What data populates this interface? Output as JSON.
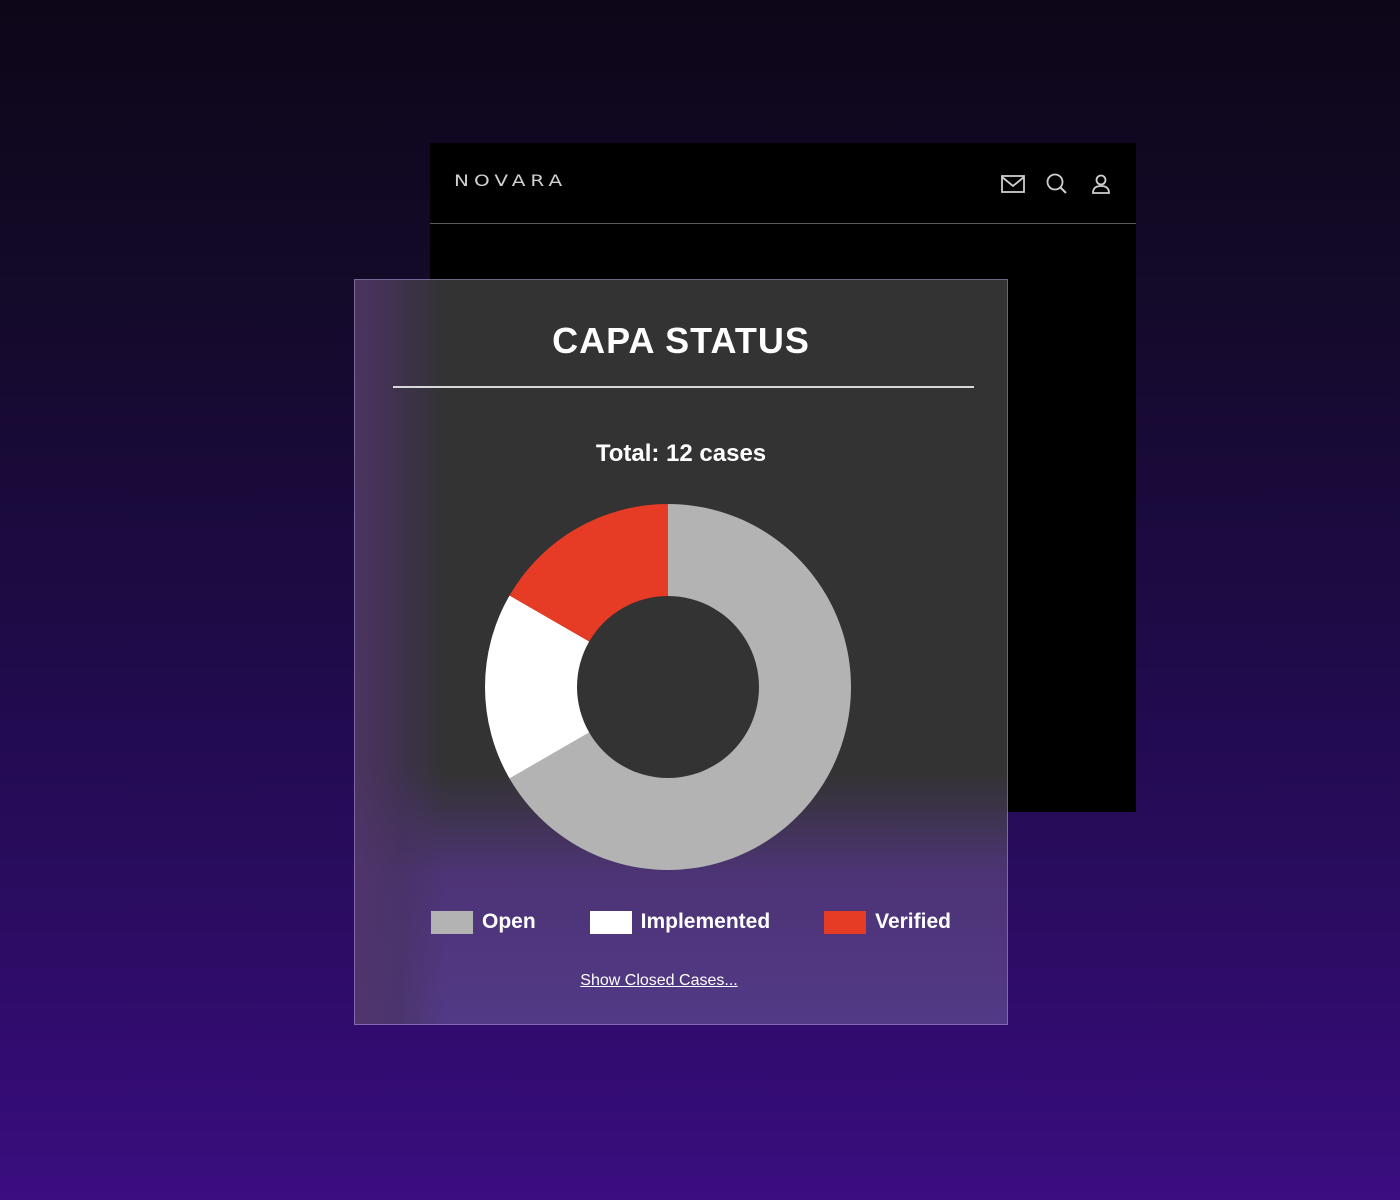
{
  "back_window": {
    "brand": "NOVARA",
    "icons": [
      "mail-icon",
      "search-icon",
      "user-icon"
    ]
  },
  "card": {
    "title": "CAPA STATUS",
    "total_label": "Total: 12 cases",
    "show_closed_link": "Show Closed Cases..."
  },
  "colors": {
    "open": "#b3b3b3",
    "implemented": "#ffffff",
    "verified": "#e63b24",
    "card_bg": "#333333"
  },
  "chart_data": {
    "type": "pie",
    "donut": true,
    "title": "CAPA STATUS",
    "subtitle": "Total: 12 cases",
    "categories": [
      "Open",
      "Implemented",
      "Verified"
    ],
    "values": [
      8,
      2,
      2
    ],
    "colors": [
      "#b3b3b3",
      "#ffffff",
      "#e63b24"
    ],
    "legend": "bottom"
  }
}
